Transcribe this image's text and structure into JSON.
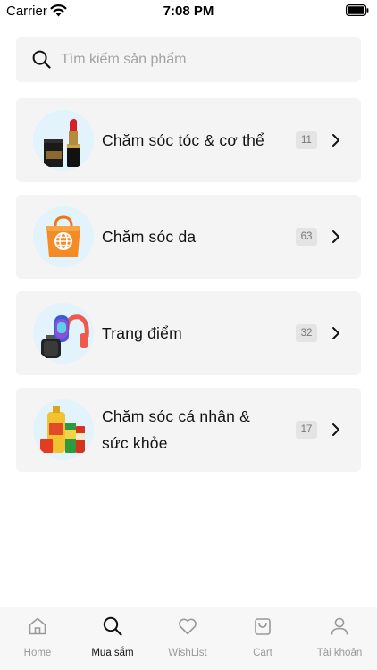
{
  "status_bar": {
    "carrier": "Carrier",
    "time": "7:08 PM"
  },
  "search": {
    "placeholder": "Tìm kiếm sản phẩm",
    "icon": "search-icon"
  },
  "categories": [
    {
      "label": "Chăm sóc tóc & cơ thể",
      "count": "11",
      "image": "lipstick-perfume"
    },
    {
      "label": "Chăm sóc da",
      "count": "63",
      "image": "shopping-bag"
    },
    {
      "label": "Trang điểm",
      "count": "32",
      "image": "gadgets"
    },
    {
      "label": "Chăm sóc cá nhân & sức khỏe",
      "count": "17",
      "image": "groceries"
    }
  ],
  "tabs": [
    {
      "label": "Home",
      "icon": "home-icon"
    },
    {
      "label": "Mua sắm",
      "icon": "search-icon",
      "active": true
    },
    {
      "label": "WishList",
      "icon": "heart-icon"
    },
    {
      "label": "Cart",
      "icon": "bag-icon"
    },
    {
      "label": "Tài khoản",
      "icon": "user-icon"
    }
  ],
  "colors": {
    "card": "#f4f4f4",
    "badge": "#e4e4e4",
    "active_tab": "#111111",
    "inactive_tab": "#999999"
  }
}
